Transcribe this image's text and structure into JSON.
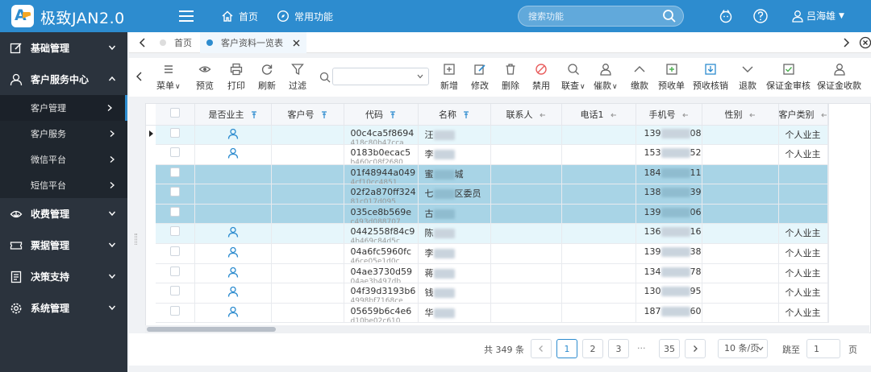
{
  "app": {
    "title": "极致JAN2.0"
  },
  "header": {
    "nav": [
      {
        "label": "首页",
        "icon": "home-icon"
      },
      {
        "label": "常用功能",
        "icon": "compass-icon"
      }
    ],
    "search_placeholder": "搜索功能",
    "user_name": "吕海雄"
  },
  "sidebar": {
    "items": [
      {
        "label": "基础管理",
        "icon": "edit-icon"
      },
      {
        "label": "客户服务中心",
        "icon": "user-icon",
        "expanded": true
      },
      {
        "label": "收费管理",
        "icon": "download-icon"
      },
      {
        "label": "票据管理",
        "icon": "ticket-icon"
      },
      {
        "label": "决策支持",
        "icon": "document-icon"
      },
      {
        "label": "系统管理",
        "icon": "gear-icon"
      }
    ],
    "sub_items": [
      {
        "label": "客户管理",
        "active": true
      },
      {
        "label": "客户服务"
      },
      {
        "label": "微信平台"
      },
      {
        "label": "短信平台"
      }
    ]
  },
  "tabs": [
    {
      "label": "首页"
    },
    {
      "label": "客户资料一览表",
      "active": true
    }
  ],
  "toolbar": {
    "buttons": [
      {
        "label": "菜单",
        "icon": "menu-icon"
      },
      {
        "label": "预览",
        "icon": "eye-icon"
      },
      {
        "label": "打印",
        "icon": "printer-icon"
      },
      {
        "label": "刷新",
        "icon": "refresh-icon"
      },
      {
        "label": "过滤",
        "icon": "filter-icon"
      },
      {
        "label": "新增",
        "icon": "add-icon"
      },
      {
        "label": "修改",
        "icon": "edit-icon"
      },
      {
        "label": "删除",
        "icon": "trash-icon"
      },
      {
        "label": "禁用",
        "icon": "ban-icon"
      },
      {
        "label": "联查",
        "icon": "search-icon"
      },
      {
        "label": "催款",
        "icon": "person-icon"
      },
      {
        "label": "缴款",
        "icon": "chevron-up-icon"
      },
      {
        "label": "预收单",
        "icon": "add-doc-icon"
      },
      {
        "label": "预收核销",
        "icon": "download-icon"
      },
      {
        "label": "退款",
        "icon": "chevron-down-icon"
      },
      {
        "label": "保证金审核",
        "icon": "check-doc-icon"
      },
      {
        "label": "保证金收款",
        "icon": "person-icon"
      }
    ]
  },
  "table": {
    "columns": [
      "是否业主",
      "客户号",
      "代码",
      "名称",
      "联系人",
      "电话1",
      "手机号",
      "性别",
      "客户类别"
    ],
    "rows": [
      {
        "owner": true,
        "code": "00c4ca5f8694",
        "code_frag": "418c80b47cca",
        "name": "汪",
        "name_tail": "",
        "phone_start": "139",
        "phone_end": "08",
        "category": "个人业主",
        "state": "hover"
      },
      {
        "owner": true,
        "code": "0183b0ecac5",
        "code_frag": "b460c08f2680",
        "name": "李",
        "name_tail": "",
        "phone_start": "153",
        "phone_end": "52",
        "category": "个人业主",
        "state": ""
      },
      {
        "owner": false,
        "code": "01f48944a049",
        "code_frag": "4cf10cc4851",
        "name": "蜜",
        "name_tail": "城",
        "phone_start": "184",
        "phone_end": "11",
        "category": "",
        "state": "sel"
      },
      {
        "owner": false,
        "code": "02f2a870ff324",
        "code_frag": "81c017d095",
        "name": "七",
        "name_tail": "区委员",
        "phone_start": "138",
        "phone_end": "39",
        "category": "",
        "state": "sel"
      },
      {
        "owner": false,
        "code": "035ce8b569e",
        "code_frag": "c493d088707",
        "name": "古",
        "name_tail": "",
        "phone_start": "139",
        "phone_end": "06",
        "category": "",
        "state": "sel"
      },
      {
        "owner": true,
        "code": "0442558f84c9",
        "code_frag": "4b469c84d5c",
        "name": "陈",
        "name_tail": "",
        "phone_start": "136",
        "phone_end": "16",
        "category": "个人业主",
        "state": "hover"
      },
      {
        "owner": true,
        "code": "04a6fc5960fc",
        "code_frag": "46ce05e1d0c",
        "name": "李",
        "name_tail": "",
        "phone_start": "139",
        "phone_end": "38",
        "category": "个人业主",
        "state": ""
      },
      {
        "owner": true,
        "code": "04ae3730d59",
        "code_frag": "04ae3b497db",
        "name": "蒋",
        "name_tail": "",
        "phone_start": "134",
        "phone_end": "78",
        "category": "个人业主",
        "state": ""
      },
      {
        "owner": true,
        "code": "04f39d3193b6",
        "code_frag": "4998bf7168ce",
        "name": "钱",
        "name_tail": "",
        "phone_start": "130",
        "phone_end": "95",
        "category": "个人业主",
        "state": ""
      },
      {
        "owner": true,
        "code": "05659b6c4e6",
        "code_frag": "d10be02c610",
        "name": "华",
        "name_tail": "",
        "phone_start": "187",
        "phone_end": "60",
        "category": "个人业主",
        "state": ""
      }
    ]
  },
  "pagination": {
    "total": "共 349 条",
    "pages": [
      "1",
      "2",
      "3",
      "35"
    ],
    "current": "1",
    "ellipsis": "···",
    "page_size": "10 条/页",
    "jump_label": "跳至",
    "jump_value": "1",
    "page_suffix": "页"
  },
  "colors": {
    "header": "#2d8ccf",
    "sidebar": "#2b333d",
    "selected_row": "#a8d4e6",
    "owner_icon": "#2d8ccf"
  }
}
